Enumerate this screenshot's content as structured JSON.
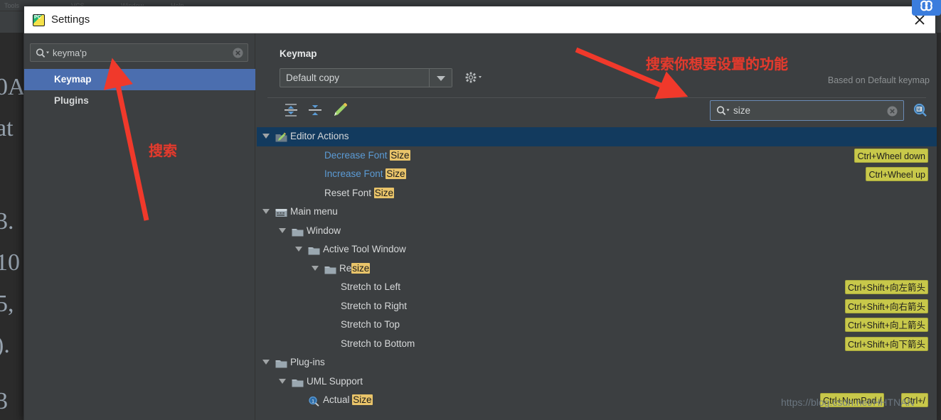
{
  "background": {
    "menu_items": [
      "Tools",
      "VCS",
      "Window",
      "Help"
    ],
    "editor_lines": [
      "0A",
      "at",
      "3.",
      "10",
      "5,",
      "). ",
      "3"
    ]
  },
  "dialog": {
    "title": "Settings",
    "app_icon": "pycharm-icon",
    "close_icon": "close-icon"
  },
  "sidebar": {
    "search": {
      "value": "keyma'p",
      "placeholder": "",
      "icon": "search-icon",
      "clear_icon": "clear-icon"
    },
    "items": [
      {
        "label": "Keymap",
        "selected": true
      },
      {
        "label": "Plugins",
        "selected": false
      }
    ]
  },
  "main": {
    "heading": "Keymap",
    "keymap_select": {
      "value": "Default copy",
      "arrow_icon": "chevron-down-icon"
    },
    "gear_icon": "gear-icon",
    "based_on": "Based on Default keymap",
    "toolbar": [
      {
        "name": "expand-all-icon",
        "title": "Expand All"
      },
      {
        "name": "collapse-all-icon",
        "title": "Collapse All"
      },
      {
        "name": "edit-shortcut-icon",
        "title": "Edit Shortcut"
      }
    ],
    "action_search": {
      "value": "size",
      "placeholder": "",
      "icon": "search-icon",
      "clear_icon": "clear-icon"
    },
    "find_shortcut_icon": "find-by-shortcut-icon",
    "tree": [
      {
        "depth": 0,
        "twisty": true,
        "icon": "editor-actions-icon",
        "label": "Editor Actions",
        "highlight": "",
        "selected": true,
        "blue": false,
        "shortcuts": []
      },
      {
        "depth": 3,
        "twisty": false,
        "icon": "",
        "label": "Decrease Font ",
        "highlight": "Size",
        "selected": false,
        "blue": true,
        "shortcuts": [
          "Ctrl+Wheel down"
        ]
      },
      {
        "depth": 3,
        "twisty": false,
        "icon": "",
        "label": "Increase Font ",
        "highlight": "Size",
        "selected": false,
        "blue": true,
        "shortcuts": [
          "Ctrl+Wheel up"
        ]
      },
      {
        "depth": 3,
        "twisty": false,
        "icon": "",
        "label": "Reset Font ",
        "highlight": "Size",
        "selected": false,
        "blue": false,
        "shortcuts": []
      },
      {
        "depth": 0,
        "twisty": true,
        "icon": "main-menu-icon",
        "label": "Main menu",
        "highlight": "",
        "selected": false,
        "blue": false,
        "shortcuts": []
      },
      {
        "depth": 1,
        "twisty": true,
        "icon": "folder-icon",
        "label": "Window",
        "highlight": "",
        "selected": false,
        "blue": false,
        "shortcuts": []
      },
      {
        "depth": 2,
        "twisty": true,
        "icon": "folder-icon",
        "label": "Active Tool Window",
        "highlight": "",
        "selected": false,
        "blue": false,
        "shortcuts": []
      },
      {
        "depth": 3,
        "twisty": true,
        "icon": "folder-icon",
        "label": "Re",
        "highlight": "size",
        "selected": false,
        "blue": false,
        "shortcuts": []
      },
      {
        "depth": 4,
        "twisty": false,
        "icon": "",
        "label": "Stretch to Left",
        "highlight": "",
        "selected": false,
        "blue": false,
        "shortcuts": [
          "Ctrl+Shift+向左箭头"
        ]
      },
      {
        "depth": 4,
        "twisty": false,
        "icon": "",
        "label": "Stretch to Right",
        "highlight": "",
        "selected": false,
        "blue": false,
        "shortcuts": [
          "Ctrl+Shift+向右箭头"
        ]
      },
      {
        "depth": 4,
        "twisty": false,
        "icon": "",
        "label": "Stretch to Top",
        "highlight": "",
        "selected": false,
        "blue": false,
        "shortcuts": [
          "Ctrl+Shift+向上箭头"
        ]
      },
      {
        "depth": 4,
        "twisty": false,
        "icon": "",
        "label": "Stretch to Bottom",
        "highlight": "",
        "selected": false,
        "blue": false,
        "shortcuts": [
          "Ctrl+Shift+向下箭头"
        ]
      },
      {
        "depth": 0,
        "twisty": true,
        "icon": "folder-icon",
        "label": "Plug-ins",
        "highlight": "",
        "selected": false,
        "blue": false,
        "shortcuts": []
      },
      {
        "depth": 1,
        "twisty": true,
        "icon": "folder-icon",
        "label": "UML Support",
        "highlight": "",
        "selected": false,
        "blue": false,
        "shortcuts": []
      },
      {
        "depth": 2,
        "twisty": false,
        "icon": "actual-size-icon",
        "label": "Actual ",
        "highlight": "Size",
        "selected": false,
        "blue": false,
        "shortcuts": [
          "Ctrl+NumPad /",
          "Ctrl+/"
        ]
      }
    ]
  },
  "annotations": {
    "search_feature_note": "搜索你想要设置的功能",
    "search_note": "搜索"
  },
  "watermark": "https://blog.csdn.net/HHTNAN",
  "colors": {
    "accent_selection": "#4b6eaf",
    "tree_selection": "#123a5e",
    "highlight_yellow": "#e9c46a",
    "shortcut_chip": "#c8c84a",
    "annotation_red": "#e03b2e",
    "panel_bg": "#3c3f41",
    "editor_bg": "#2b2b2b"
  }
}
